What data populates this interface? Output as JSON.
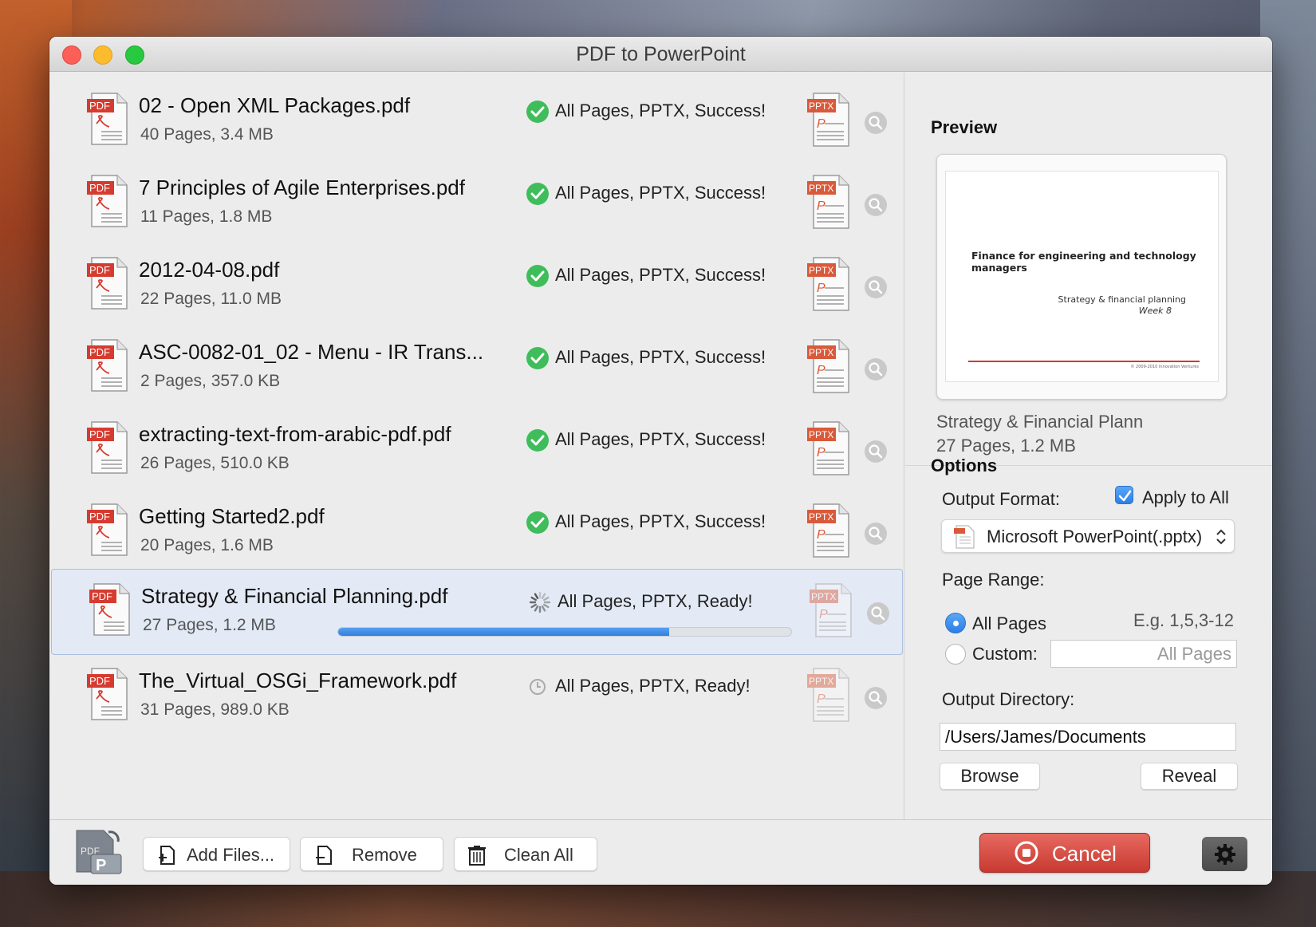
{
  "window": {
    "title": "PDF to PowerPoint"
  },
  "files": [
    {
      "name": "02 - Open XML Packages.pdf",
      "meta": "40 Pages, 3.4 MB",
      "status": "All Pages, PPTX, Success!",
      "state": "success"
    },
    {
      "name": "7 Principles of Agile Enterprises.pdf",
      "meta": "11 Pages, 1.8 MB",
      "status": "All Pages, PPTX, Success!",
      "state": "success"
    },
    {
      "name": "2012-04-08.pdf",
      "meta": "22 Pages, 11.0 MB",
      "status": "All Pages, PPTX, Success!",
      "state": "success"
    },
    {
      "name": "ASC-0082-01_02 - Menu - IR Trans...",
      "meta": "2 Pages, 357.0 KB",
      "status": "All Pages, PPTX, Success!",
      "state": "success"
    },
    {
      "name": "extracting-text-from-arabic-pdf.pdf",
      "meta": "26 Pages, 510.0 KB",
      "status": "All Pages, PPTX, Success!",
      "state": "success"
    },
    {
      "name": "Getting Started2.pdf",
      "meta": "20 Pages, 1.6 MB",
      "status": "All Pages, PPTX, Success!",
      "state": "success"
    },
    {
      "name": "Strategy & Financial Planning.pdf",
      "meta": "27 Pages, 1.2 MB",
      "status": "All Pages, PPTX, Ready!",
      "state": "converting",
      "progress": 0.73
    },
    {
      "name": "The_Virtual_OSGi_Framework.pdf",
      "meta": "31 Pages, 989.0 KB",
      "status": "All Pages, PPTX, Ready!",
      "state": "pending"
    }
  ],
  "icons": {
    "pdf_badge": "PDF",
    "pptx_badge": "PPTX",
    "pptx_letter": "P"
  },
  "preview": {
    "heading": "Preview",
    "slide_title": "Finance for engineering and technology managers",
    "slide_subtitle": "Strategy & financial planning",
    "slide_week": "Week 8",
    "slide_footer": "© 2009-2010 Innovation Ventures",
    "file_name": "Strategy & Financial Plann",
    "file_meta": "27 Pages, 1.2 MB"
  },
  "options": {
    "heading": "Options",
    "output_format_label": "Output Format:",
    "apply_to_all": "Apply to All",
    "format_value": "Microsoft PowerPoint(.pptx)",
    "page_range_label": "Page Range:",
    "all_pages": "All Pages",
    "example": "E.g. 1,5,3-12",
    "custom": "Custom:",
    "custom_placeholder": "All Pages",
    "output_dir_label": "Output Directory:",
    "output_dir_value": "/Users/James/Documents",
    "browse": "Browse",
    "reveal": "Reveal"
  },
  "footer": {
    "logo_text": "PDF",
    "add_files": "Add Files...",
    "remove": "Remove",
    "clean_all": "Clean All",
    "cancel": "Cancel"
  },
  "colors": {
    "success": "#3fbd5b",
    "accent": "#2c7fe6",
    "cancel": "#d4463c",
    "pdf_red": "#d63b30"
  }
}
